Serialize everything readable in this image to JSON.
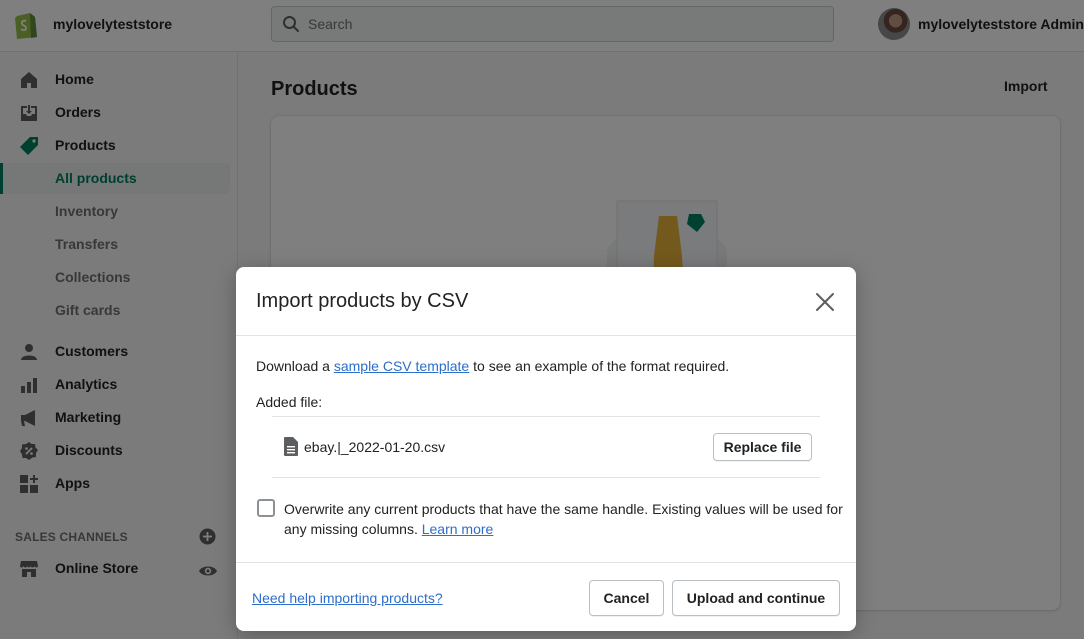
{
  "header": {
    "store_name": "mylovelyteststore",
    "search_placeholder": "Search",
    "user_name": "mylovelyteststore Admin"
  },
  "sidebar": {
    "items": [
      {
        "label": "Home",
        "icon": "home-icon"
      },
      {
        "label": "Orders",
        "icon": "orders-icon"
      },
      {
        "label": "Products",
        "icon": "tag-icon"
      }
    ],
    "product_subitems": [
      "All products",
      "Inventory",
      "Transfers",
      "Collections",
      "Gift cards"
    ],
    "more_items": [
      {
        "label": "Customers",
        "icon": "person-icon"
      },
      {
        "label": "Analytics",
        "icon": "bar-chart-icon"
      },
      {
        "label": "Marketing",
        "icon": "megaphone-icon"
      },
      {
        "label": "Discounts",
        "icon": "discount-icon"
      },
      {
        "label": "Apps",
        "icon": "apps-icon"
      }
    ],
    "sales_channels_title": "SALES CHANNELS",
    "online_store": "Online Store"
  },
  "main": {
    "title": "Products",
    "import_label": "Import"
  },
  "modal": {
    "title": "Import products by CSV",
    "desc_prefix": "Download a",
    "desc_link": "sample CSV template",
    "desc_suffix": "to see an example of the format required.",
    "added_file_label": "Added file:",
    "file_name": "ebay.|_2022-01-20.csv",
    "replace_button": "Replace file",
    "overwrite_text": "Overwrite any current products that have the same handle. Existing values will be used for any missing columns.",
    "learn_more": "Learn more",
    "overwrite_checked": false,
    "help_link": "Need help importing products?",
    "cancel_button": "Cancel",
    "upload_button": "Upload and continue"
  },
  "colors": {
    "accent_green": "#008060",
    "link_blue": "#2c6ecb"
  }
}
